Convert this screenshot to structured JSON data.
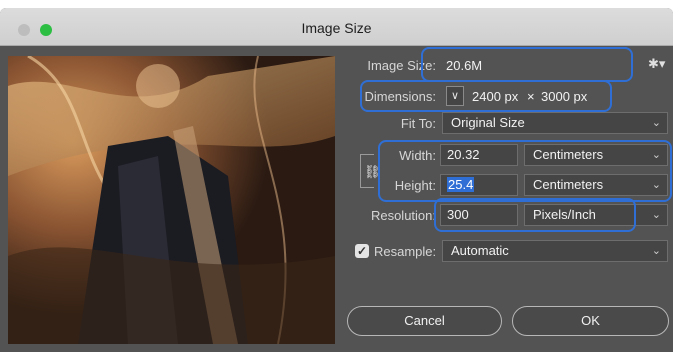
{
  "window": {
    "title": "Image Size"
  },
  "image_size": {
    "label": "Image Size:",
    "value": "20.6M"
  },
  "dimensions": {
    "label": "Dimensions:",
    "width": "2400 px",
    "separator": "×",
    "height": "3000 px"
  },
  "fit_to": {
    "label": "Fit To:",
    "value": "Original Size"
  },
  "width": {
    "label": "Width:",
    "value": "20.32",
    "unit": "Centimeters"
  },
  "height": {
    "label": "Height:",
    "value": "25.4",
    "unit": "Centimeters"
  },
  "resolution": {
    "label": "Resolution:",
    "value": "300",
    "unit": "Pixels/Inch"
  },
  "resample": {
    "label": "Resample:",
    "checked": true,
    "value": "Automatic"
  },
  "buttons": {
    "cancel": "Cancel",
    "ok": "OK"
  },
  "icons": {
    "gear": "gear-icon",
    "link": "link-icon",
    "chevron": "chevron-down-icon",
    "checkmark": "checkmark-icon"
  },
  "colors": {
    "highlight": "#2f6fd5",
    "panel": "#535353"
  }
}
